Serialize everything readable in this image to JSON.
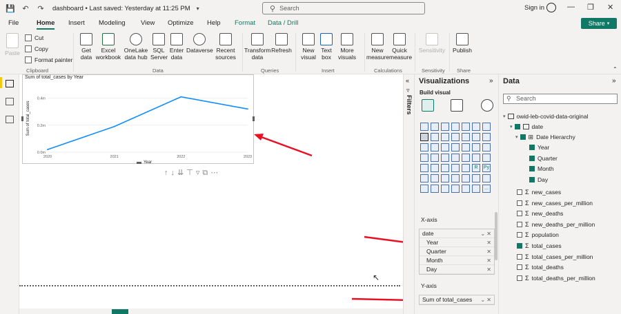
{
  "titlebar": {
    "doc_title": "dashboard • Last saved: Yesterday at 11:25 PM",
    "search_placeholder": "Search",
    "sign_in": "Sign in"
  },
  "menu": {
    "tabs": [
      "File",
      "Home",
      "Insert",
      "Modeling",
      "View",
      "Optimize",
      "Help",
      "Format",
      "Data / Drill"
    ],
    "active": "Home",
    "share": "Share"
  },
  "ribbon": {
    "clipboard": {
      "paste": "Paste",
      "cut": "Cut",
      "copy": "Copy",
      "format_painter": "Format painter",
      "group": "Clipboard"
    },
    "data": {
      "get_data": "Get data",
      "excel_workbook": "Excel workbook",
      "onelake": "OneLake data hub",
      "sql_server": "SQL Server",
      "enter_data": "Enter data",
      "dataverse": "Dataverse",
      "recent_sources": "Recent sources",
      "group": "Data"
    },
    "queries": {
      "transform_data": "Transform data",
      "refresh": "Refresh",
      "group": "Queries"
    },
    "insert": {
      "new_visual": "New visual",
      "text_box": "Text box",
      "more_visuals": "More visuals",
      "group": "Insert"
    },
    "calculations": {
      "new_measure": "New measure",
      "quick_measure": "Quick measure",
      "group": "Calculations"
    },
    "sensitivity": {
      "label": "Sensitivity",
      "group": "Sensitivity"
    },
    "share": {
      "publish": "Publish",
      "group": "Share"
    }
  },
  "visual": {
    "title": "Sum of total_cases by Year"
  },
  "chart_data": {
    "type": "line",
    "title": "Sum of total_cases by Year",
    "xlabel": "Year",
    "ylabel": "Sum of total_cases",
    "categories": [
      "2020",
      "2021",
      "2022",
      "2023"
    ],
    "x_tick_labels": [
      "2020",
      "2021",
      "2022",
      "2023"
    ],
    "values": [
      0.02,
      0.19,
      0.41,
      0.32
    ],
    "y_ticks": [
      "0.0m",
      "0.2m",
      "0.4m"
    ],
    "ylim": [
      0,
      0.5
    ],
    "series_color": "#118dff",
    "grid": true
  },
  "filters": {
    "label": "Filters"
  },
  "visualizations": {
    "title": "Visualizations",
    "build_visual": "Build visual",
    "x_axis_label": "X-axis",
    "x_axis_fields": [
      "date",
      "Year",
      "Quarter",
      "Month",
      "Day"
    ],
    "y_axis_label": "Y-axis",
    "y_axis_fields": [
      "Sum of total_cases"
    ],
    "icon_glyphs": [
      "",
      "",
      "",
      "",
      "",
      "",
      "",
      "",
      "",
      "",
      "",
      "",
      "",
      "",
      "",
      "",
      "",
      "",
      "",
      "",
      "",
      "",
      "",
      "",
      "",
      "",
      "",
      "",
      "",
      "",
      "",
      "",
      "",
      "R",
      "Py",
      "",
      "",
      "",
      "",
      "",
      "",
      "",
      "",
      "",
      "",
      "",
      "",
      "",
      "..."
    ]
  },
  "data_pane": {
    "title": "Data",
    "search_placeholder": "Search",
    "table_name": "owid-leb-covid-data-original",
    "date_field": "date",
    "hierarchy": "Date Hierarchy",
    "hierarchy_levels": [
      "Year",
      "Quarter",
      "Month",
      "Day"
    ],
    "fields": [
      {
        "name": "new_cases",
        "checked": false
      },
      {
        "name": "new_cases_per_million",
        "checked": false
      },
      {
        "name": "new_deaths",
        "checked": false
      },
      {
        "name": "new_deaths_per_million",
        "checked": false
      },
      {
        "name": "population",
        "checked": false
      },
      {
        "name": "total_cases",
        "checked": true
      },
      {
        "name": "total_cases_per_million",
        "checked": false
      },
      {
        "name": "total_deaths",
        "checked": false
      },
      {
        "name": "total_deaths_per_million",
        "checked": false
      }
    ]
  },
  "colors": {
    "accent": "#117865",
    "arrow": "#e81123"
  }
}
